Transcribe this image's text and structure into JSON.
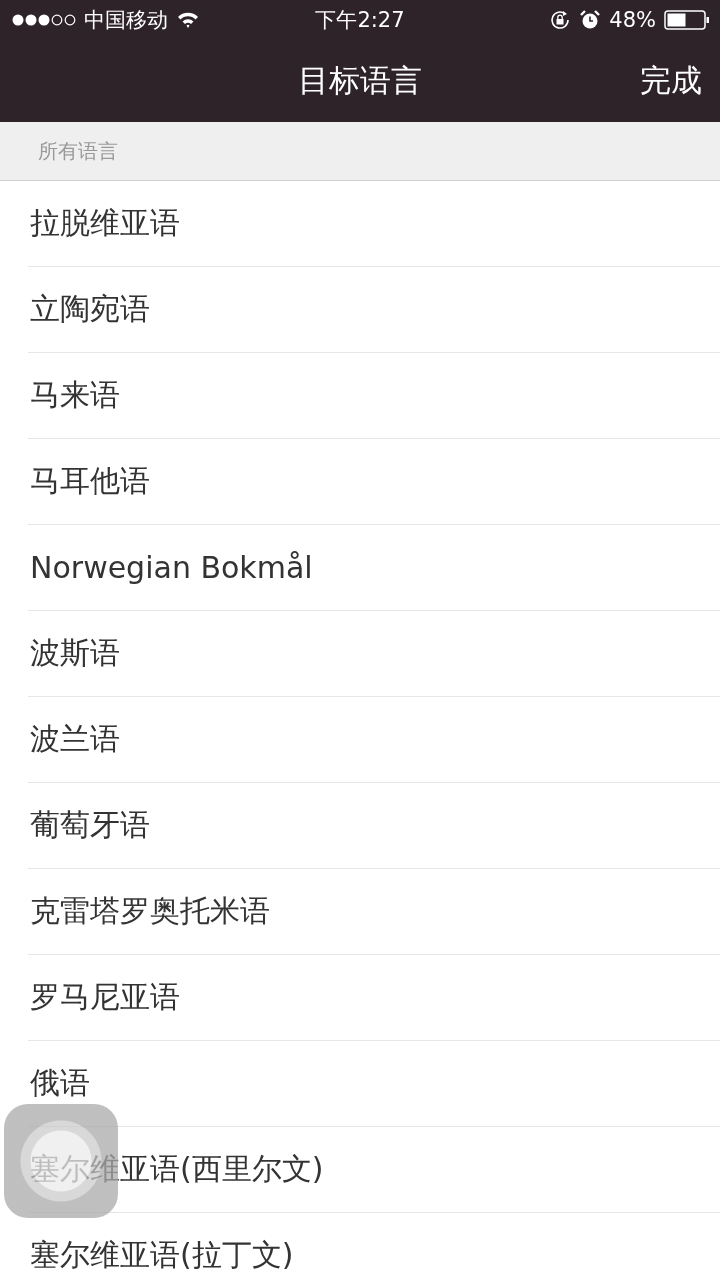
{
  "status_bar": {
    "carrier": "中国移动",
    "time": "下午2:27",
    "battery": "48%"
  },
  "nav_bar": {
    "title": "目标语言",
    "done": "完成"
  },
  "section_header": "所有语言",
  "languages": [
    "拉脱维亚语",
    "立陶宛语",
    "马来语",
    "马耳他语",
    "Norwegian Bokmål",
    "波斯语",
    "波兰语",
    "葡萄牙语",
    "克雷塔罗奥托米语",
    "罗马尼亚语",
    "俄语",
    "塞尔维亚语(西里尔文)",
    "塞尔维亚语(拉丁文)"
  ]
}
